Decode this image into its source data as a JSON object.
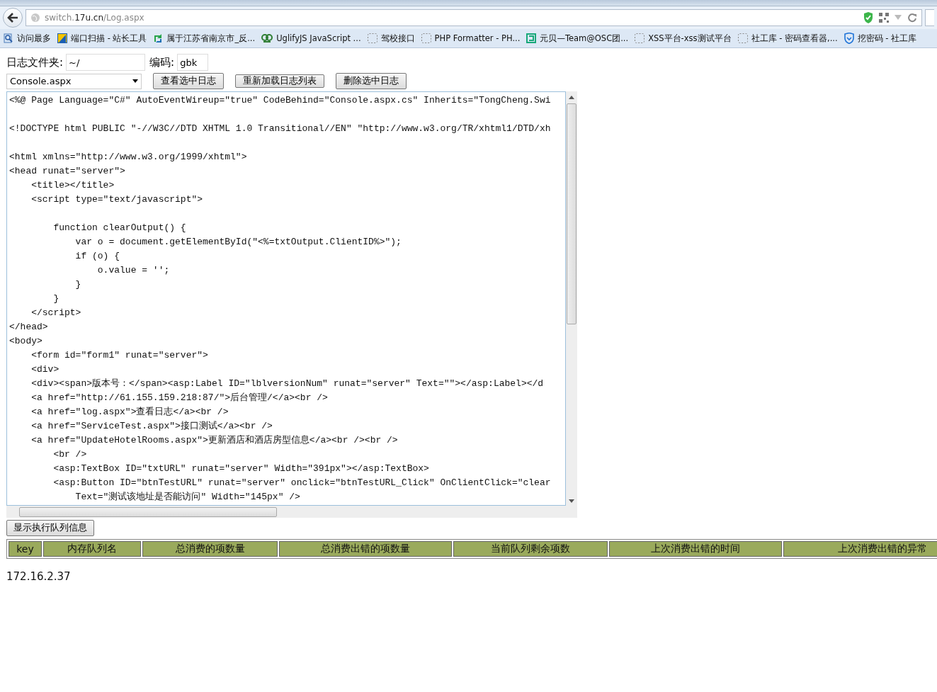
{
  "browser": {
    "address": {
      "host_prefix": "switch.",
      "host_domain": "17u.cn",
      "path": "/Log.aspx"
    },
    "bookmarks": [
      {
        "label": "访问最多",
        "kind": "search"
      },
      {
        "label": "端口扫描 - 站长工具",
        "kind": "tile"
      },
      {
        "label": "属于江苏省南京市_反...",
        "kind": "arrows"
      },
      {
        "label": "UglifyJS JavaScript ...",
        "kind": "owl"
      },
      {
        "label": "驾校接口",
        "kind": "blank"
      },
      {
        "label": "PHP Formatter - PH...",
        "kind": "blank"
      },
      {
        "label": "元贝—Team@OSC团...",
        "kind": "bracket"
      },
      {
        "label": "XSS平台-xss测试平台",
        "kind": "blank"
      },
      {
        "label": "社工库 - 密码查看器,...",
        "kind": "blank"
      },
      {
        "label": "挖密码 - 社工库",
        "kind": "shield"
      }
    ]
  },
  "form": {
    "folder_label": "日志文件夹:",
    "folder_value": "~/",
    "encoding_label": "编码:",
    "encoding_value": "gbk",
    "file_select": "Console.aspx",
    "buttons": [
      "查看选中日志",
      "重新加载日志列表",
      "删除选中日志"
    ]
  },
  "code_view": {
    "value": "<%@ Page Language=\"C#\" AutoEventWireup=\"true\" CodeBehind=\"Console.aspx.cs\" Inherits=\"TongCheng.Swi\n\n<!DOCTYPE html PUBLIC \"-//W3C//DTD XHTML 1.0 Transitional//EN\" \"http://www.w3.org/TR/xhtml1/DTD/xh\n\n<html xmlns=\"http://www.w3.org/1999/xhtml\">\n<head runat=\"server\">\n    <title></title>\n    <script type=\"text/javascript\">\n\n        function clearOutput() {\n            var o = document.getElementById(\"<%=txtOutput.ClientID%>\");\n            if (o) {\n                o.value = '';\n            }\n        }\n    </script>\n</head>\n<body>\n    <form id=\"form1\" runat=\"server\">\n    <div>\n    <div><span>版本号：</span><asp:Label ID=\"lblversionNum\" runat=\"server\" Text=\"\"></asp:Label></d\n    <a href=\"http://61.155.159.218:87/\">后台管理/</a><br />\n    <a href=\"log.aspx\">查看日志</a><br />\n    <a href=\"ServiceTest.aspx\">接口测试</a><br />\n    <a href=\"UpdateHotelRooms.aspx\">更新酒店和酒店房型信息</a><br /><br />\n        <br />\n        <asp:TextBox ID=\"txtURL\" runat=\"server\" Width=\"391px\"></asp:TextBox>\n        <asp:Button ID=\"btnTestURL\" runat=\"server\" onclick=\"btnTestURL_Click\" OnClientClick=\"clear\n            Text=\"测试该地址是否能访问\" Width=\"145px\" />"
  },
  "queue_button": "显示执行队列信息",
  "queue_table": {
    "columns": [
      "key",
      "内存队列名",
      "总消费的项数量",
      "总消费出错的项数量",
      "当前队列剩余项数",
      "上次消费出错的时间",
      "上次消费出错的异常"
    ]
  },
  "server_ip": "172.16.2.37"
}
